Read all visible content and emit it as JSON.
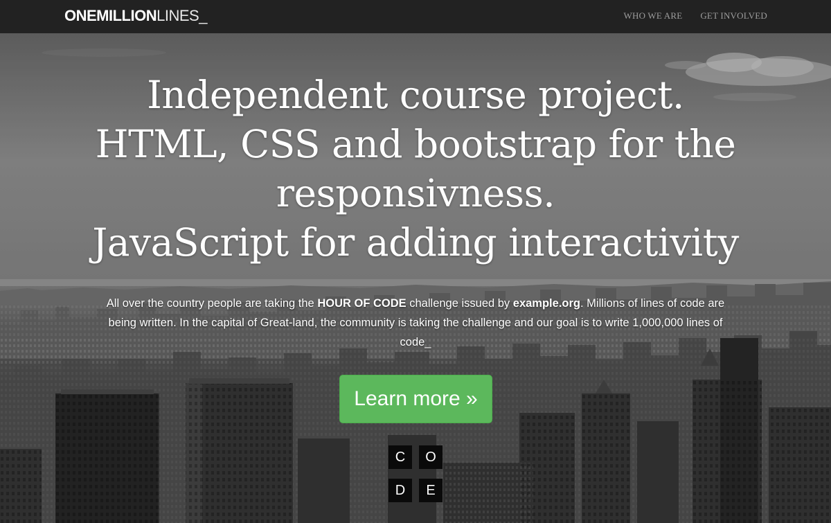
{
  "navbar": {
    "brand_bold": "ONEMILLION",
    "brand_light": "LINES_",
    "links": [
      {
        "label": "WHO WE ARE"
      },
      {
        "label": "GET INVOLVED"
      }
    ]
  },
  "hero": {
    "headline_lines": [
      "Independent course project.",
      "HTML, CSS and bootstrap for the",
      "responsivness.",
      "JavaScript for adding interactivity"
    ],
    "lead": {
      "part1": "All over the country people are taking the ",
      "strong1": "HOUR OF CODE",
      "part2": " challenge issued by ",
      "strong2": "example.org",
      "part3": ". Millions of lines of code are being written. In the capital of Great-land, the community is taking the challenge and our goal is to write 1,000,000 lines of code_"
    },
    "button_label": "Learn more »",
    "code_logo_letters": [
      "C",
      "O",
      "D",
      "E"
    ]
  },
  "colors": {
    "navbar_bg": "#222222",
    "nav_link": "#9d9d9d",
    "button_green": "#5cb85c",
    "text_white": "#ffffff"
  }
}
